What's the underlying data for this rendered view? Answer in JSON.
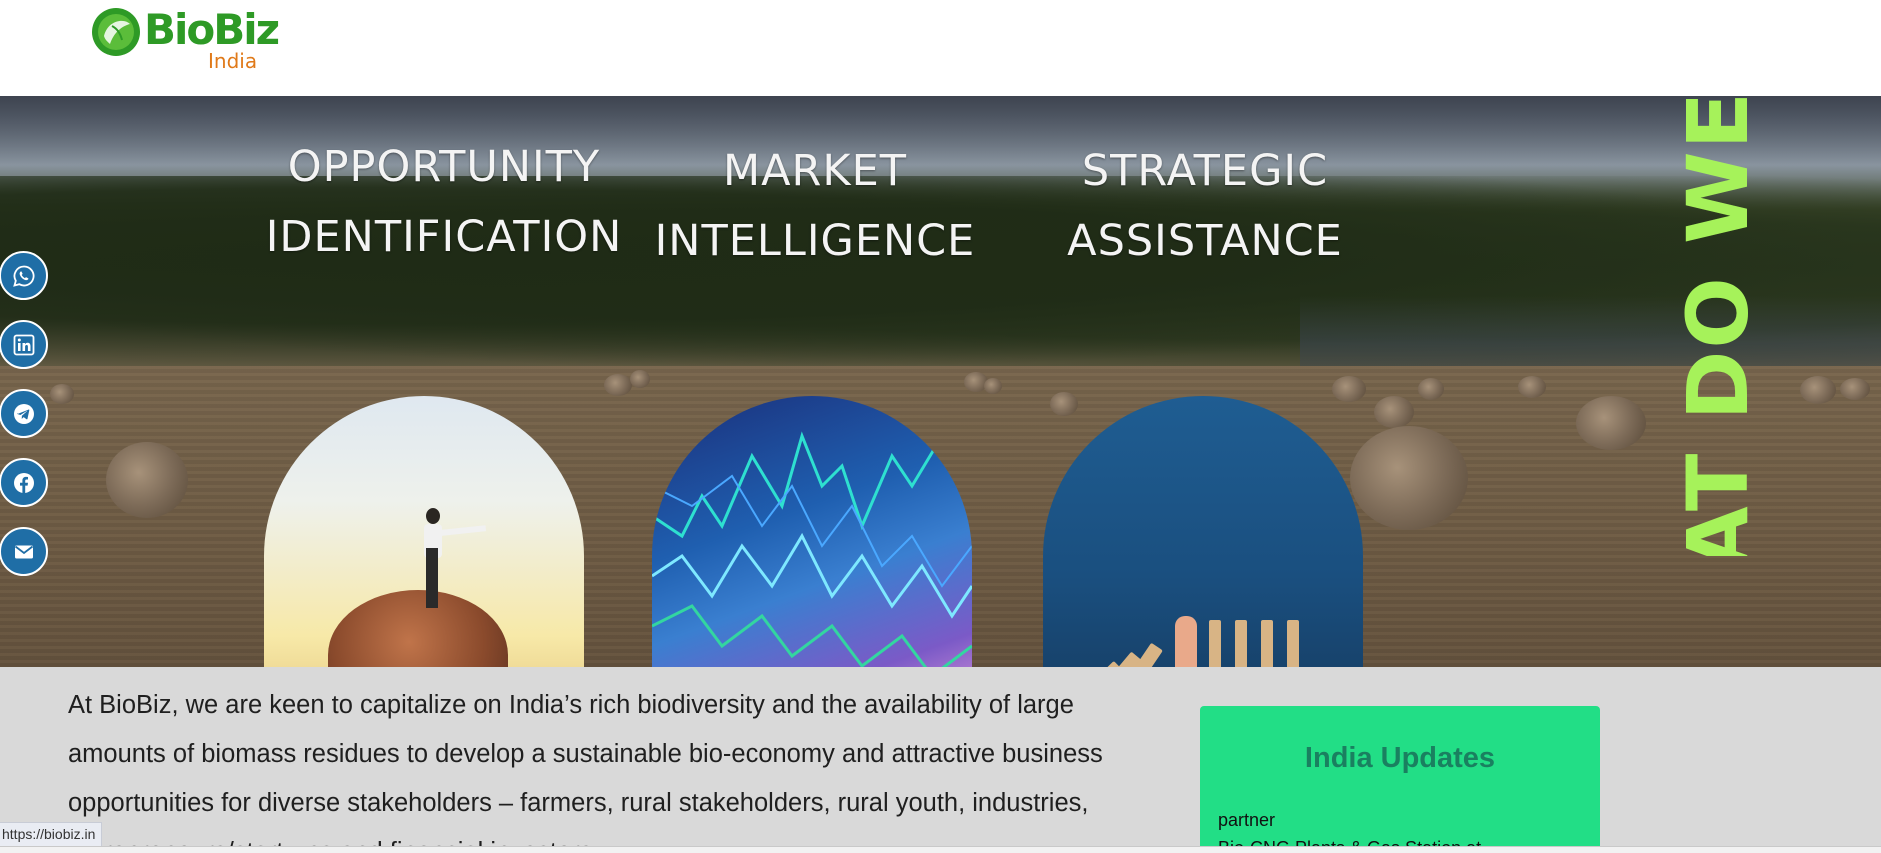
{
  "header": {
    "logo": {
      "name": "BioBiz",
      "sub": "India"
    }
  },
  "hero": {
    "services": [
      {
        "line1": "OPPORTUNITY",
        "line2": "IDENTIFICATION"
      },
      {
        "line1": "MARKET",
        "line2": "INTELLIGENCE"
      },
      {
        "line1": "STRATEGIC",
        "line2": "ASSISTANCE"
      }
    ],
    "vertical_heading": "WHAT DO WE DO"
  },
  "social": {
    "items": [
      {
        "icon": "whatsapp-icon"
      },
      {
        "icon": "linkedin-icon"
      },
      {
        "icon": "telegram-icon"
      },
      {
        "icon": "facebook-icon"
      },
      {
        "icon": "email-icon"
      }
    ],
    "color": "#1f6ea6"
  },
  "intro": {
    "text": "At BioBiz, we are keen to capitalize on India’s rich biodiversity and the availability of large amounts of biomass residues to develop a sustainable bio-economy and attractive business opportunities for diverse stakeholders – farmers, rural stakeholders, rural youth, industries, entrepreneurs/start-ups and financial investors."
  },
  "updates": {
    "title": "India Updates",
    "items": [
      "partner",
      "Bio-CNG Plants & Gas Station at..."
    ],
    "color": "#22de86"
  },
  "status_bar": {
    "url": "https://biobiz.in"
  }
}
